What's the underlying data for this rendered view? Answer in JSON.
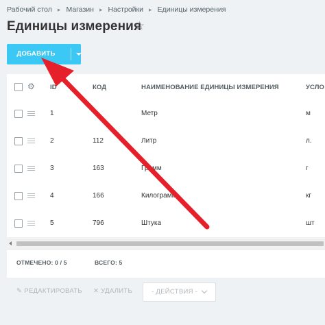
{
  "breadcrumb": [
    "Рабочий стол",
    "Магазин",
    "Настройки",
    "Единицы измерения"
  ],
  "page": {
    "title": "Единицы измерения"
  },
  "toolbar": {
    "add_label": "ДОБАВИТЬ"
  },
  "table": {
    "columns": [
      "ID",
      "КОД",
      "НАИМЕНОВАНИЕ ЕДИНИЦЫ ИЗМЕРЕНИЯ",
      "УСЛО"
    ],
    "rows": [
      {
        "id": "1",
        "code": "",
        "name": "Метр",
        "symbol": "м"
      },
      {
        "id": "2",
        "code": "112",
        "name": "Литр",
        "symbol": "л."
      },
      {
        "id": "3",
        "code": "163",
        "name": "Грамм",
        "symbol": "г"
      },
      {
        "id": "4",
        "code": "166",
        "name": "Килограмм",
        "symbol": "кг"
      },
      {
        "id": "5",
        "code": "796",
        "name": "Штука",
        "symbol": "шт"
      }
    ]
  },
  "footer": {
    "selected_label": "ОТМЕЧЕНО:",
    "selected_value": "0 / 5",
    "total_label": "ВСЕГО:",
    "total_value": "5"
  },
  "actions": {
    "edit": "РЕДАКТИРОВАТЬ",
    "delete": "УДАЛИТЬ",
    "select_value": "- ДЕЙСТВИЯ -"
  },
  "annotation": {
    "arrow_color": "#e5202a"
  },
  "icons": [
    "star-icon",
    "gear-icon",
    "pencil-icon",
    "x-icon",
    "caret-down-icon"
  ]
}
